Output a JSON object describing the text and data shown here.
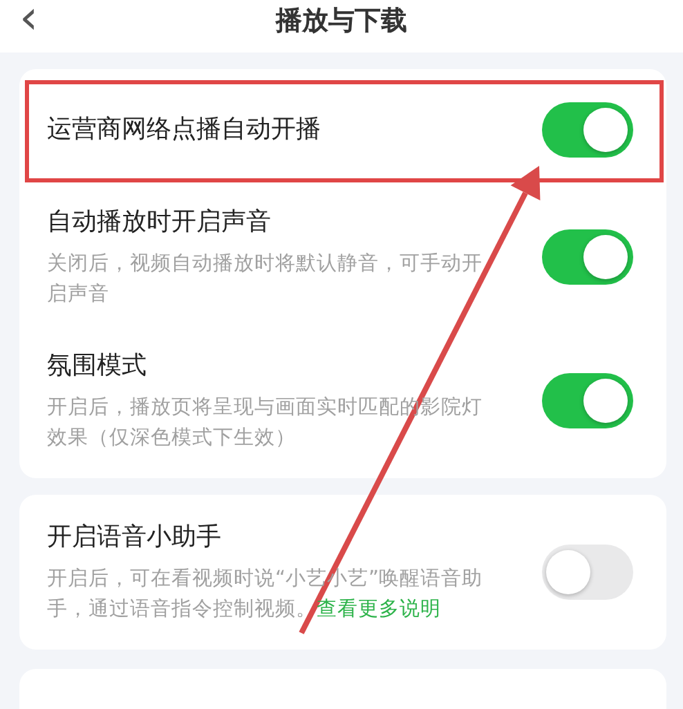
{
  "header": {
    "back_icon": "‹",
    "title": "播放与下载"
  },
  "groups": [
    {
      "items": [
        {
          "title": "运营商网络点播自动开播",
          "on": true,
          "highlighted": true
        },
        {
          "title": "自动播放时开启声音",
          "description": "关闭后，视频自动播放时将默认静音，可手动开启声音",
          "on": true,
          "highlighted": false
        },
        {
          "title": "氛围模式",
          "description": "开启后，播放页将呈现与画面实时匹配的影院灯效果（仅深色模式下生效）",
          "on": true,
          "highlighted": false
        }
      ]
    },
    {
      "items": [
        {
          "title": "开启语音小助手",
          "description": "开启后，可在看视频时说“小艺小艺”唤醒语音助手，通过语音指令控制视频。",
          "link": "查看更多说明",
          "on": false,
          "highlighted": false
        }
      ]
    }
  ]
}
